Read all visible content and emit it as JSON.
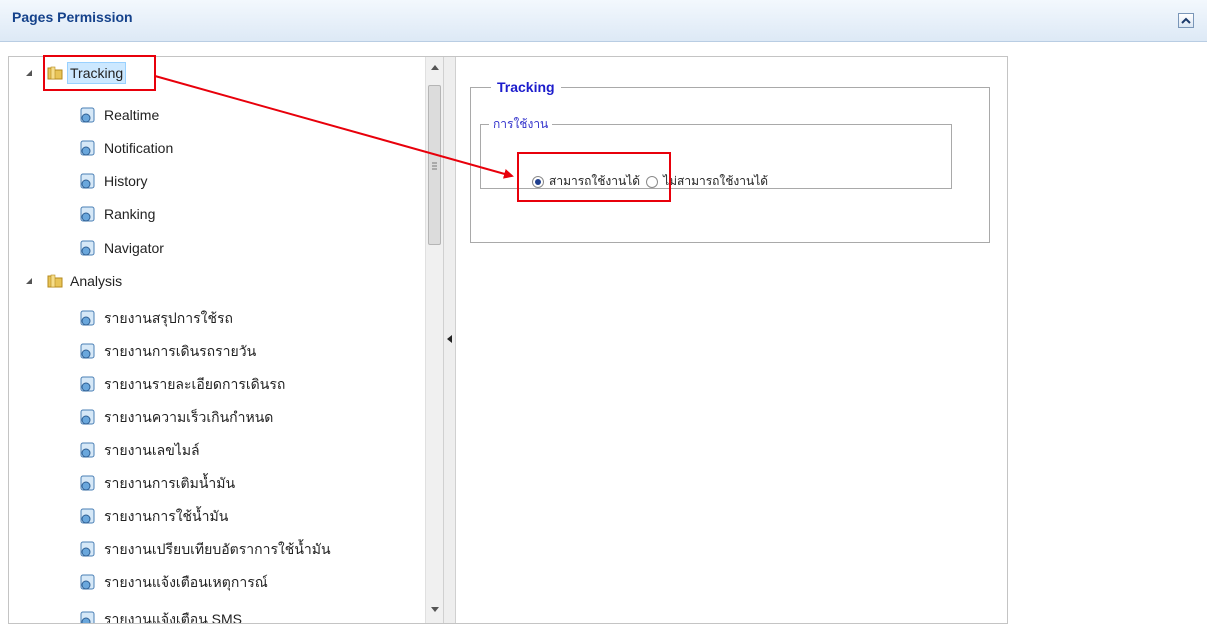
{
  "header": {
    "title": "Pages Permission"
  },
  "tree": {
    "groups": [
      {
        "label": "Tracking",
        "items": [
          "Realtime",
          "Notification",
          "History",
          "Ranking",
          "Navigator"
        ]
      },
      {
        "label": "Analysis",
        "items": [
          "รายงานสรุปการใช้รถ",
          "รายงานการเดินรถรายวัน",
          "รายงานรายละเอียดการเดินรถ",
          "รายงานความเร็วเกินกำหนด",
          "รายงานเลขไมล์",
          "รายงานการเติมน้ำมัน",
          "รายงานการใช้น้ำมัน",
          "รายงานเปรียบเทียบอัตราการใช้น้ำมัน",
          "รายงานแจ้งเตือนเหตุการณ์",
          "รายงานแจ้งเตือน SMS"
        ]
      }
    ]
  },
  "permission": {
    "title": "Tracking",
    "usage_legend": "การใช้งาน",
    "options": [
      "สามารถใช้งานได้",
      "ไม่สามารถใช้งานได้"
    ],
    "selected": "สามารถใช้งานได้"
  },
  "colors": {
    "annotation": "#e8000b",
    "legend_text": "#1c1ccc",
    "header_text": "#15428b"
  }
}
